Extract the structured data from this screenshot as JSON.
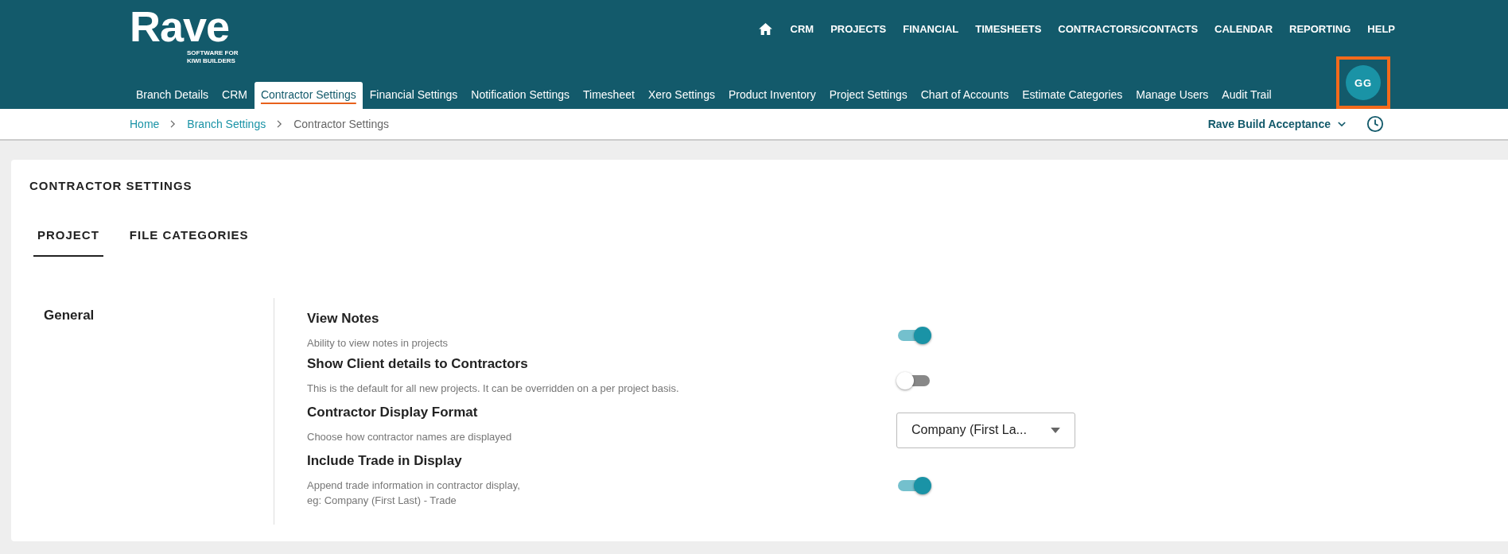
{
  "logo": {
    "wordmark": "Rave",
    "tagline_lines": [
      "SOFTWARE FOR",
      "KIWI BUILDERS"
    ]
  },
  "top_nav": [
    "CRM",
    "PROJECTS",
    "FINANCIAL",
    "TIMESHEETS",
    "CONTRACTORS/CONTACTS",
    "CALENDAR",
    "REPORTING",
    "HELP"
  ],
  "settings_nav": [
    {
      "label": "Branch Details",
      "selected": false
    },
    {
      "label": "CRM",
      "selected": false
    },
    {
      "label": "Contractor Settings",
      "selected": true
    },
    {
      "label": "Financial Settings",
      "selected": false
    },
    {
      "label": "Notification Settings",
      "selected": false
    },
    {
      "label": "Timesheet",
      "selected": false
    },
    {
      "label": "Xero Settings",
      "selected": false
    },
    {
      "label": "Product Inventory",
      "selected": false
    },
    {
      "label": "Project Settings",
      "selected": false
    },
    {
      "label": "Chart of Accounts",
      "selected": false
    },
    {
      "label": "Estimate Categories",
      "selected": false
    },
    {
      "label": "Manage Users",
      "selected": false
    },
    {
      "label": "Audit Trail",
      "selected": false
    }
  ],
  "avatar": {
    "initials": "GG",
    "highlighted": true
  },
  "breadcrumb": [
    "Home",
    "Branch Settings",
    "Contractor Settings"
  ],
  "branch_selector": "Rave Build Acceptance",
  "page_title": "CONTRACTOR SETTINGS",
  "tabs": [
    {
      "label": "PROJECT",
      "selected": true
    },
    {
      "label": "FILE CATEGORIES",
      "selected": false
    }
  ],
  "section": {
    "title": "General",
    "settings": [
      {
        "kind": "toggle",
        "title": "View Notes",
        "description": "Ability to view notes in projects",
        "on": true
      },
      {
        "kind": "toggle",
        "title": "Show Client details to Contractors",
        "description": "This is the default for all new projects. It can be overridden on a per project basis.",
        "on": false
      },
      {
        "kind": "select",
        "title": "Contractor Display Format",
        "description": "Choose how contractor names are displayed",
        "value": "Company (First La..."
      },
      {
        "kind": "toggle",
        "title": "Include Trade in Display",
        "description": "Append trade information in contractor display,\neg: Company (First Last) - Trade",
        "on": true
      }
    ]
  }
}
